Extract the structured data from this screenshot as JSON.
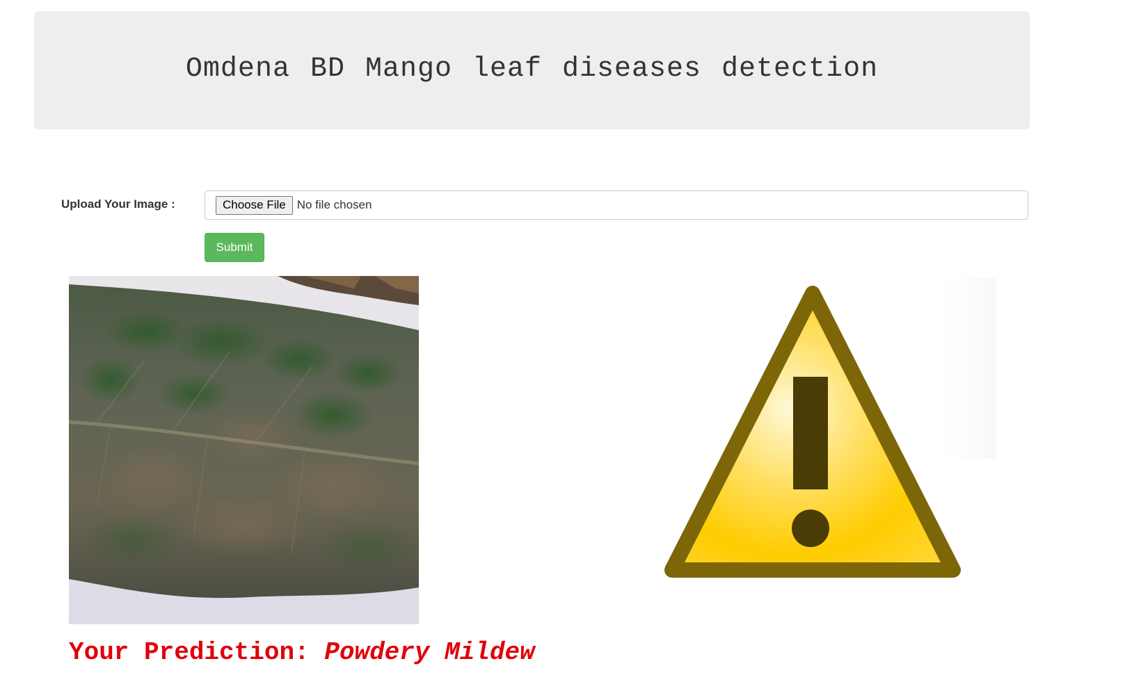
{
  "header": {
    "title": "Omdena BD Mango leaf diseases detection"
  },
  "upload": {
    "label": "Upload Your Image :",
    "choose_button": "Choose File",
    "no_file_text": "No file chosen"
  },
  "form": {
    "submit_label": "Submit"
  },
  "images": {
    "uploaded": "mango-leaf-photo",
    "result_icon": "warning-icon"
  },
  "prediction": {
    "label": "Your Prediction:",
    "value": "Powdery Mildew"
  },
  "colors": {
    "header_bg": "#eeeeee",
    "submit_bg": "#5cb85c",
    "prediction_text": "#e0000b",
    "warning_fill": "#ffcc00",
    "warning_border": "#7d6608"
  }
}
